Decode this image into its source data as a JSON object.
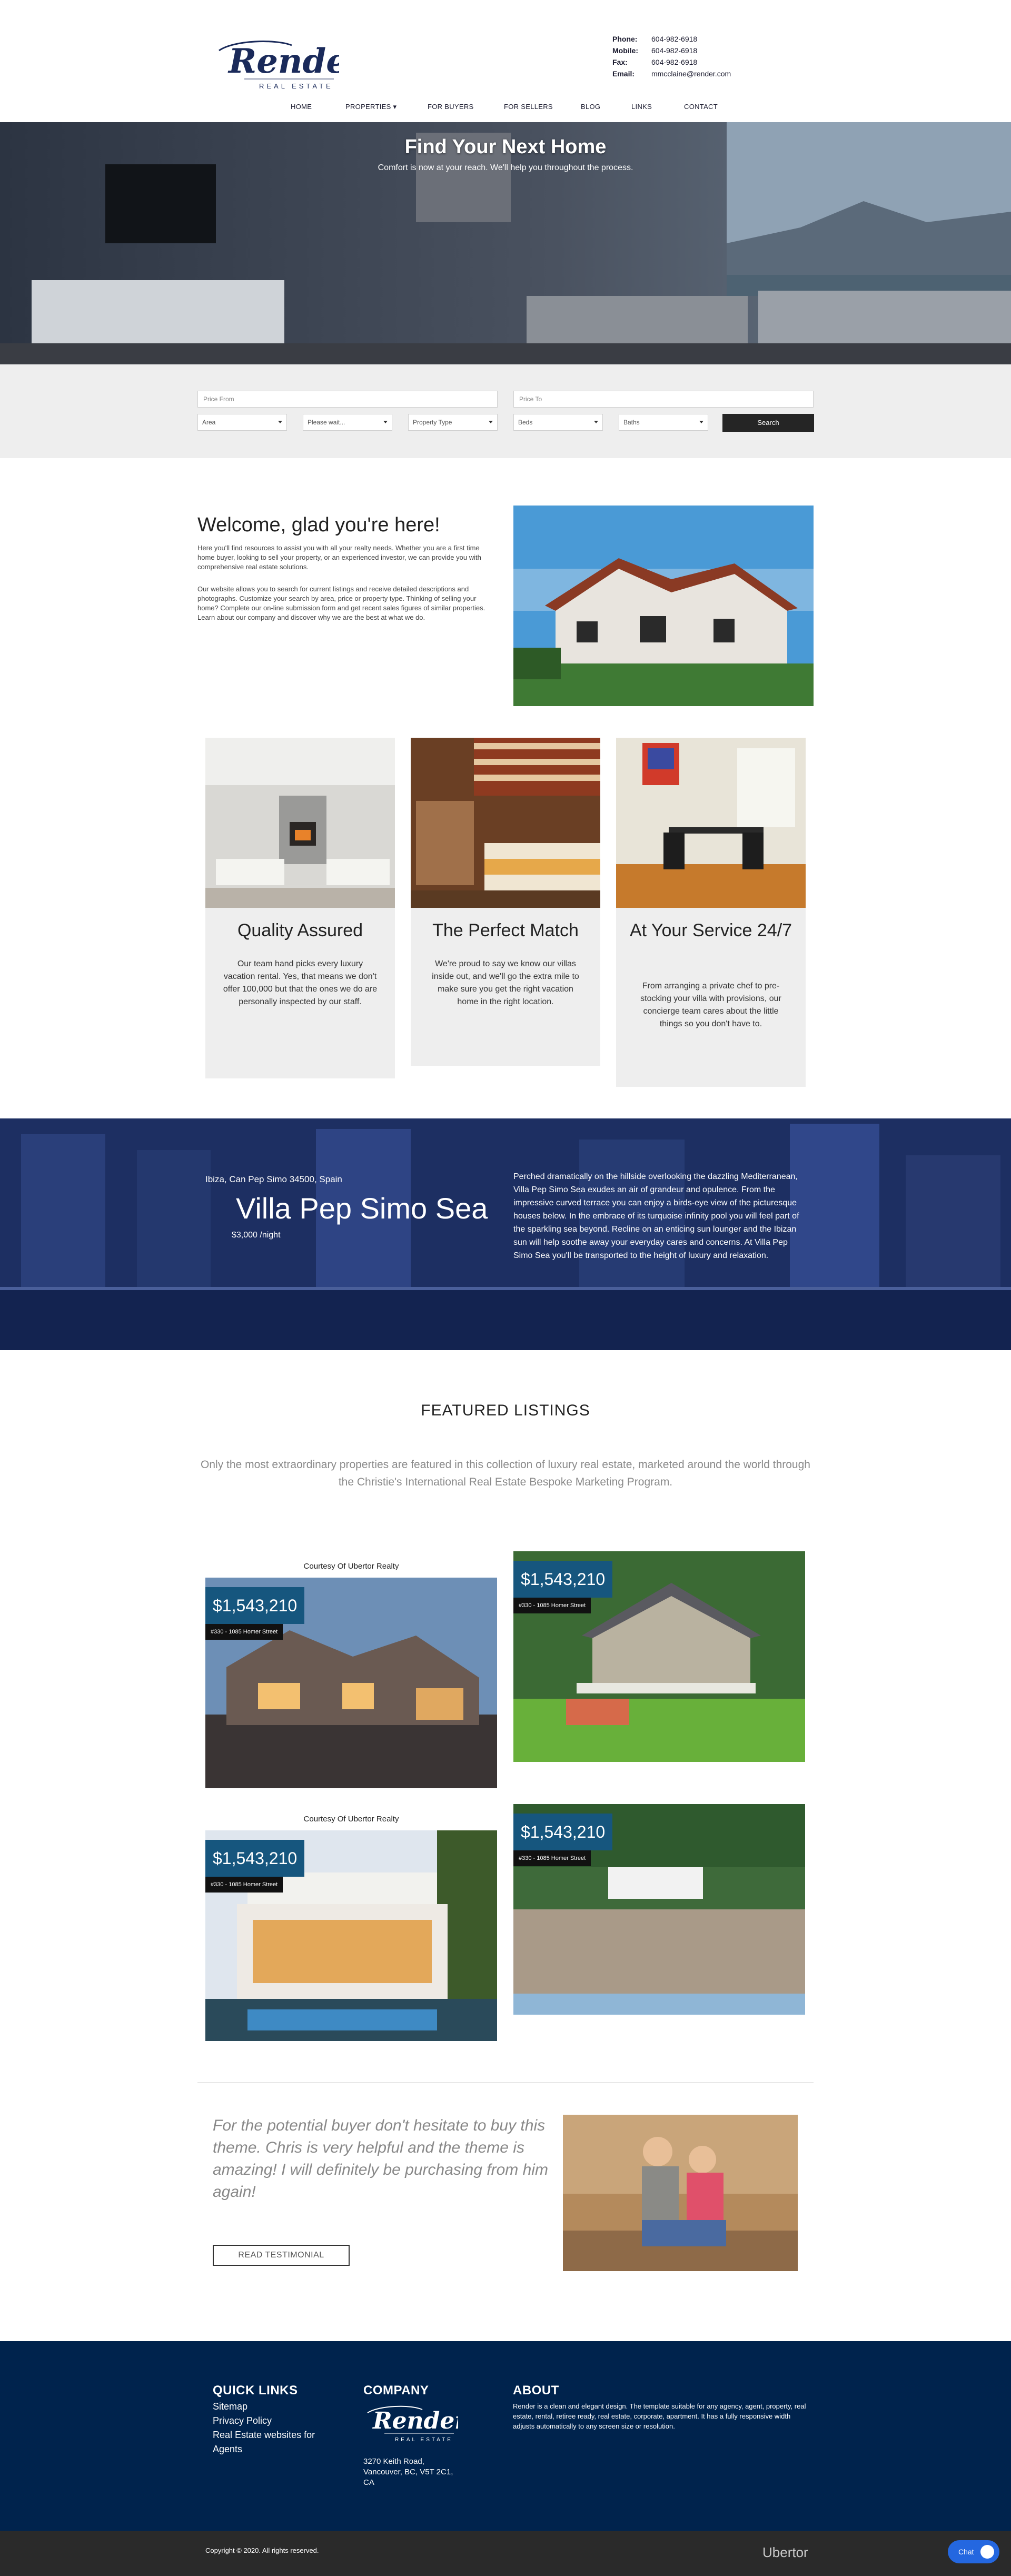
{
  "header": {
    "logo_script": "Render",
    "logo_sub": "REAL ESTATE",
    "contacts": [
      {
        "label": "Phone:",
        "value": "604-982-6918"
      },
      {
        "label": "Mobile:",
        "value": "604-982-6918"
      },
      {
        "label": "Fax:",
        "value": "604-982-6918"
      },
      {
        "label": "Email:",
        "value": "mmcclaine@render.com"
      }
    ],
    "nav": [
      "HOME",
      "PROPERTIES",
      "FOR BUYERS",
      "FOR SELLERS",
      "BLOG",
      "LINKS",
      "CONTACT"
    ]
  },
  "hero": {
    "title": "Find Your Next Home",
    "subtitle": "Comfort is now at your reach. We'll help you throughout the process."
  },
  "search": {
    "price_from": "Price From",
    "price_to": "Price To",
    "selects": [
      "Area",
      "Please wait...",
      "Property Type",
      "Beds",
      "Baths"
    ],
    "button": "Search"
  },
  "welcome": {
    "title": "Welcome, glad you're here!",
    "p1": "Here you'll find resources to assist you with all your realty needs. Whether you are a first time home buyer, looking to sell your property, or an experienced investor, we can provide you with comprehensive real estate solutions.",
    "p2": "Our website allows you to search for current listings and receive detailed descriptions and photographs. Customize your search by area, price or property type. Thinking of selling your home? Complete our on-line submission form and get recent sales figures of similar properties. Learn about our company and discover why we are the best at what we do."
  },
  "cards": [
    {
      "title": "Quality Assured",
      "text": "Our team hand picks every luxury vacation rental. Yes, that means we don't offer 100,000 but that the ones we do are personally inspected by our staff."
    },
    {
      "title": "The Perfect Match",
      "text": "We're proud to say we know our villas inside out, and we'll go the extra mile to make sure you get the right vacation home in the right location."
    },
    {
      "title": "At Your Service 24/7",
      "text": "From arranging a private chef to pre-stocking your villa with provisions, our concierge team cares about the little things so you don't have to."
    }
  ],
  "villa": {
    "location": "Ibiza, Can Pep Simo 34500, Spain",
    "name": "Villa Pep Simo Sea",
    "price": "$3,000 /night",
    "description": "Perched dramatically on the hillside overlooking the dazzling Mediterranean, Villa Pep Simo Sea exudes an air of grandeur and opulence. From the impressive curved terrace you can enjoy a birds-eye view of the picturesque houses below. In the embrace of its turquoise infinity pool you will feel part of the sparkling sea beyond. Recline on an enticing sun lounger and the Ibizan sun will help soothe away your everyday cares and concerns. At Villa Pep Simo Sea you'll be transported to the height of luxury and relaxation."
  },
  "featured": {
    "title": "FEATURED LISTINGS",
    "subtitle": "Only the most extraordinary properties are featured in this collection of luxury real estate, marketed around the world through the Christie's International Real Estate Bespoke Marketing Program.",
    "listings": [
      {
        "courtesy": "Courtesy Of Ubertor Realty",
        "price": "$1,543,210",
        "address": "#330 - 1085 Homer Street"
      },
      {
        "courtesy": "",
        "price": "$1,543,210",
        "address": "#330 - 1085 Homer Street"
      },
      {
        "courtesy": "Courtesy Of Ubertor Realty",
        "price": "$1,543,210",
        "address": "#330 - 1085 Homer Street"
      },
      {
        "courtesy": "",
        "price": "$1,543,210",
        "address": "#330 - 1085 Homer Street"
      }
    ]
  },
  "testimonial": {
    "quote": "For the potential buyer don't hesitate to buy this theme. Chris is very helpful and the theme is amazing! I will definitely be purchasing from him again!",
    "button": "READ TESTIMONIAL"
  },
  "footer": {
    "quick_links_title": "QUICK LINKS",
    "quick_links": [
      "Sitemap",
      "Privacy Policy",
      "Real Estate websites for",
      "Agents"
    ],
    "company_title": "COMPANY",
    "address": [
      "3270 Keith Road,",
      "Vancouver, BC, V5T 2C1,",
      "CA"
    ],
    "about_title": "ABOUT",
    "about_text": "Render is a clean and elegant design. The template suitable for any agency, agent, property, real estate, rental, retiree ready, real estate, corporate, apartment. It has a fully responsive width adjusts automatically to any screen size or resolution.",
    "copyright": "Copyright © 2020. All rights reserved.",
    "powered": "Ubertor",
    "chat": "Chat"
  },
  "colors": {
    "navy": "#00234d",
    "price_blue": "#16567e",
    "search_bg": "#eeeeee",
    "chat_blue": "#2467e0"
  }
}
